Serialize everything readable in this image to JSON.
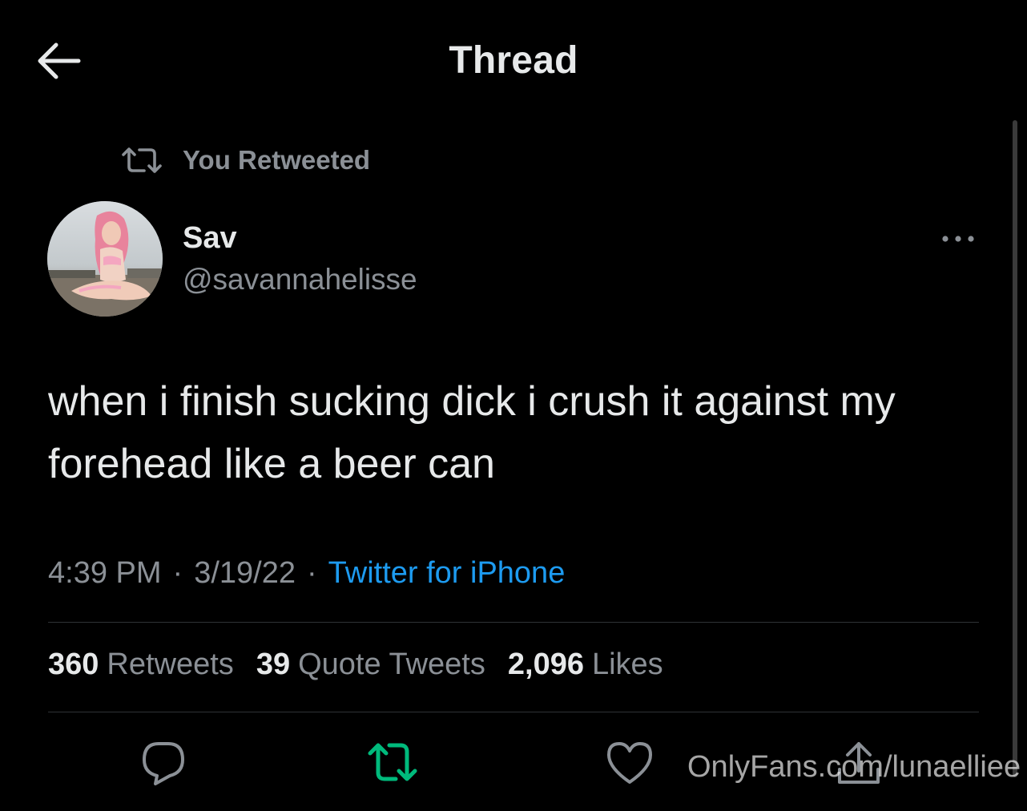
{
  "header": {
    "title": "Thread"
  },
  "retweet_context": {
    "label": "You Retweeted"
  },
  "tweet": {
    "display_name": "Sav",
    "username": "@savannahelisse",
    "text": "when i finish sucking dick i crush it against my forehead like a beer can",
    "time": "4:39 PM",
    "date": "3/19/22",
    "source": "Twitter for iPhone",
    "separator": "·",
    "stats": {
      "retweets_count": "360",
      "retweets_label": "Retweets",
      "quotes_count": "39",
      "quotes_label": "Quote Tweets",
      "likes_count": "2,096",
      "likes_label": "Likes"
    },
    "retweeted_by_user": true
  },
  "watermark": {
    "text": "OnlyFans.com/lunaelliee"
  },
  "icons": {
    "back": "arrow-left-icon",
    "retweet_context": "retweet-icon",
    "more": "more-horizontal-icon",
    "reply": "reply-icon",
    "retweet": "retweet-icon",
    "like": "heart-icon",
    "share": "share-icon"
  },
  "colors": {
    "background": "#000000",
    "text_primary": "#e7e9ea",
    "text_secondary": "#8b9096",
    "link": "#1d9bf0",
    "retweet_active": "#00ba7c",
    "divider": "#2f3336"
  }
}
